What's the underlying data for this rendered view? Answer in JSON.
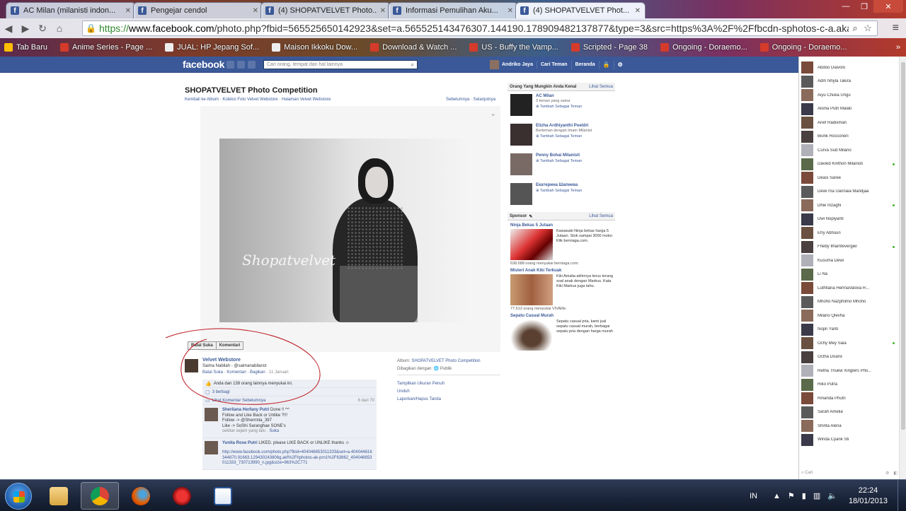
{
  "browser": {
    "tabs": [
      {
        "title": "AC Milan (milanisti indon...",
        "active": false
      },
      {
        "title": "Pengejar cendol",
        "active": false
      },
      {
        "title": "(4) SHOPATVELVET Photo...",
        "active": false
      },
      {
        "title": "Informasi Pemulihan Aku...",
        "active": false
      },
      {
        "title": "(4) SHOPATVELVET Phot...",
        "active": true
      }
    ],
    "url_scheme": "https://",
    "url_domain": "www.facebook.com",
    "url_rest": "/photo.php?fbid=565525650142923&set=a.565525143476307.144190.178909482137877&type=3&src=https%3A%2F%2Ffbcdn-sphotos-c-a.akan",
    "bookmarks": [
      "Tab Baru",
      "Anime Series - Page ...",
      "JUAL: HP Jepang Sof...",
      "Maison Ikkoku Dow...",
      "Download & Watch ...",
      "US - Buffy the Vamp...",
      "Scripted - Page 38",
      "Ongoing - Doraemo...",
      "Ongoing - Doraemo..."
    ],
    "bookmarks_more": "»"
  },
  "fb": {
    "logo": "facebook",
    "search_placeholder": "Cari orang, tempat dan hal lainnya",
    "user_name": "Andriko Jaya",
    "find_friends": "Cari Teman",
    "home": "Beranda"
  },
  "photo": {
    "title": "SHOPATVELVET Photo Competition",
    "breadcrumb": "Kembali ke Album · Koleksi Foto Velvet Webstore · Halaman Velvet Webstore",
    "pager": "Sebelumnya · Selanjutnya",
    "watermark": "Shopatvelvet",
    "unlike_label": "Batal Suka",
    "comment_label": "Komentari",
    "owner_name": "Velvet Webstore",
    "caption": "Saima Nabilah - @saimanabilanst",
    "meta_links": "Batal Suka · Komentari · Bagikan",
    "meta_date": "· 11 Januari",
    "album_label": "Album:",
    "album_name": "SHOPATVELVET Photo Competition",
    "shared_label": "Dibagikan dengan:",
    "shared_value": "Publik",
    "album_links": [
      "Tampilkan Ukuran Penuh",
      "Unduh",
      "Laporkan/Hapus Tanda"
    ]
  },
  "ufi": {
    "likes": "Anda dan 138 orang lainnya menyukai ini.",
    "shares": "3 berbagi",
    "prev_comments": "Lihat Komentar Sebelumnya",
    "count": "6 dari 70",
    "comments": [
      {
        "name": "Sherliana Herfany Putri",
        "lines": [
          "Done !! ^^",
          "Follow and Like Back or Unlike ?!!!",
          "Follow -> @Sherrnita_397",
          "Like -> SoShi Saranghae SONE's"
        ],
        "time": "sekitar sejam yang lalu",
        "action": "Suka"
      },
      {
        "name": "Yunita Rose Putri",
        "lines": [
          "LIKED. please LIKE BACK or UNLIKE thanks"
        ],
        "link": "http://www.facebook.com/photo.php?fbid=404046653011333&set=a.404044616344870.91663.129430243806g.akf%2Fhphotos-ak-prn1%2F63862_404046653011333_730713990_n.jpg&size=963%2C771"
      }
    ]
  },
  "sidebar": {
    "pymk_title": "Orang Yang Mungkin Anda Kenal",
    "see_all": "Lihat Semua",
    "pymk": [
      {
        "name": "AC Milan",
        "sub": "3 teman yang sama",
        "action": "Tambah Sebagai Teman"
      },
      {
        "name": "Elizha Ardhiyanthi Poetdri",
        "sub": "Berteman dengan Imam Milanist",
        "action": "Tambah Sebagai Teman"
      },
      {
        "name": "Penny Bohai Milanisti",
        "sub": "",
        "action": "Tambah Sebagai Teman"
      },
      {
        "name": "Екатерина Шапеева",
        "sub": "",
        "action": "Tambah Sebagai Teman"
      }
    ],
    "sponsor_title": "Sponsor",
    "ads": [
      {
        "title": "Ninja Bekas 5 Jutaan",
        "text": "Kawasaki Ninja bekas harga 5 Jutaan. Stok sampai 3000 motor. Klik berniaga.com.",
        "likes": "638.688 orang menyukai berniaga.com."
      },
      {
        "title": "Misteri Anak Kiki Terkuak",
        "text": "Kiki Amalia akhirnya terus terang soal anak dengan Markus. Kata Kiki Markus juga tahu.",
        "likes": "77.613 orang menyukai VIVAlife."
      },
      {
        "title": "Sepatu Casual Murah",
        "text": "Sepatu casual pria, kami jual sepatu casual murah, berbagai sepatu pria dengan harga murah",
        "likes": ""
      }
    ]
  },
  "chat": {
    "friends": [
      {
        "name": "Abdoo Diavolo",
        "online": false
      },
      {
        "name": "Adm Nhyla Takira",
        "online": false
      },
      {
        "name": "Aiyu Chuka Ungu",
        "online": false
      },
      {
        "name": "Alisha Putri Malati",
        "online": false
      },
      {
        "name": "Arief Radixman",
        "online": false
      },
      {
        "name": "Bionk Rossoneri",
        "online": false
      },
      {
        "name": "Curva Sud Milano",
        "online": false
      },
      {
        "name": "Davied Kinthon Milanisti",
        "online": true
      },
      {
        "name": "Deasi Saree",
        "online": false
      },
      {
        "name": "DewiTha Uannaia Mandjaa",
        "online": false
      },
      {
        "name": "Dhie Inzaghi",
        "online": true
      },
      {
        "name": "Dwi Nopiyanti",
        "online": false
      },
      {
        "name": "Efry Abhoun",
        "online": false
      },
      {
        "name": "Fheby Ilhamfevergiel",
        "online": true
      },
      {
        "name": "Kusuma Dewi",
        "online": false
      },
      {
        "name": "Li Na",
        "online": false
      },
      {
        "name": "Luthfiana HermaValova R...",
        "online": false
      },
      {
        "name": "Mhoho Nazphilmo Mhoho",
        "online": false
      },
      {
        "name": "Milano Qlevha",
        "online": false
      },
      {
        "name": "Nopri Yanti",
        "online": false
      },
      {
        "name": "Ochy Mey Saia",
        "online": true
      },
      {
        "name": "Octha Doanx",
        "online": false
      },
      {
        "name": "Retha Thuew Xinglers Pho...",
        "online": false
      },
      {
        "name": "Riko Putra",
        "online": false
      },
      {
        "name": "Rinanda Phutri",
        "online": false
      },
      {
        "name": "Sarah Amelia",
        "online": false
      },
      {
        "name": "Shinta Alena",
        "online": false
      },
      {
        "name": "Winda Cyank Sti",
        "online": false
      }
    ],
    "search_placeholder": "Cari"
  },
  "taskbar": {
    "lang": "IN",
    "time": "22:24",
    "date": "18/01/2013"
  }
}
